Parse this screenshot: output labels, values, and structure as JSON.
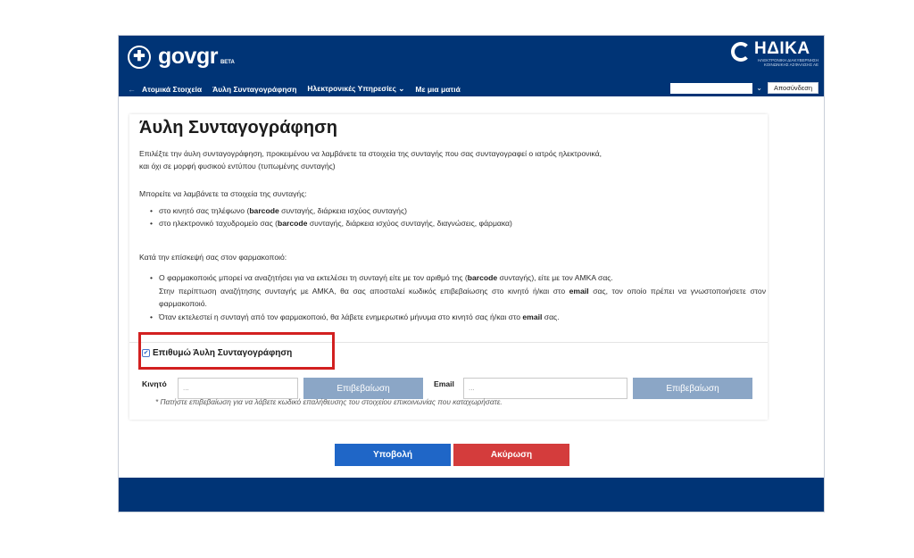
{
  "colors": {
    "header_bg": "#003476",
    "primary_button": "#1f66c7",
    "danger_button": "#d43c3c",
    "confirm_button": "#8ba6c6",
    "highlight_border": "#d22020"
  },
  "header": {
    "logo_gov": "gov",
    "logo_gr": "gr",
    "logo_beta": "BETA",
    "emblem_icon": "greek-emblem-icon",
    "org_name": "ΗΔΙΚΑ",
    "org_subtitle": "ΗΛΕΚΤΡΟΝΙΚΗ ΔΙΑΚΥΒΕΡΝΗΣΗ ΚΟΙΝΩΝΙΚΗΣ ΑΣΦΑΛΙΣΗΣ ΑΕ",
    "nav_items": [
      "Ατομικά Στοιχεία",
      "Άυλη Συνταγογράφηση",
      "Ηλεκτρονικές Υπηρεσίες ⌄",
      "Με μια ματιά"
    ],
    "user_select_value": "",
    "logout_label": "Αποσύνδεση"
  },
  "main": {
    "title": "Άυλη Συνταγογράφηση",
    "intro_line1": "Επιλέξτε την άυλη συνταγογράφηση, προκειμένου να λαμβάνετε τα στοιχεία της συνταγής που σας συνταγογραφεί ο ιατρός ηλεκτρονικά,",
    "intro_line2": "και όχι σε μορφή φυσικού εντύπου (τυπωμένης συνταγής)",
    "receive_heading": "Μπορείτε να λαμβάνετε τα στοιχεία της συνταγής:",
    "receive_items": [
      {
        "pre": "στο κινητό σας τηλέφωνο (",
        "kw": "barcode",
        "post": " συνταγής, διάρκεια ισχύος συνταγής)"
      },
      {
        "pre": "στο ηλεκτρονικό ταχυδρομείο σας (",
        "kw": "barcode",
        "post": " συνταγής, διάρκεια ισχύος συνταγής, διαγνώσεις, φάρμακα)"
      }
    ],
    "pharmacy_heading": "Κατά την επίσκεψή σας στον φαρμακοποιό:",
    "pharmacy_item1_pre": "Ο φαρμακοποιός μπορεί να αναζητήσει για να εκτελέσει τη συνταγή είτε με τον αριθμό της (",
    "pharmacy_item1_kw": "barcode",
    "pharmacy_item1_post": " συνταγής), είτε με τον ΑΜΚΑ σας.",
    "pharmacy_item1_cont_pre": "Στην περίπτωση αναζήτησης συνταγής με ΑΜΚΑ, θα σας αποσταλεί κωδικός επιβεβαίωσης στο κινητό ή/και στο ",
    "pharmacy_item1_cont_kw": "email",
    "pharmacy_item1_cont_post": " σας, τον οποίο πρέπει να γνωστοποιήσετε στον φαρμακοποιό.",
    "pharmacy_item2_pre": "Όταν εκτελεστεί η συνταγή από τον φαρμακοποιό, θα λάβετε ενημερωτικό μήνυμα στο κινητό σας ή/και στο ",
    "pharmacy_item2_kw": "email",
    "pharmacy_item2_post": " σας.",
    "checkbox_label": "Επιθυμώ Άυλη Συνταγογράφηση",
    "checkbox_checked": true,
    "mobile_label": "Κινητό",
    "mobile_placeholder": "...",
    "mobile_confirm_label": "Επιβεβαίωση",
    "email_label": "Email",
    "email_placeholder": "...",
    "email_confirm_label": "Επιβεβαίωση",
    "hint": "* Πατήστε επιβεβαίωση για να λάβετε κωδικό επαλήθευσης του στοιχείου επικοινωνίας που καταχωρήσατε."
  },
  "actions": {
    "submit_label": "Υποβολή",
    "cancel_label": "Ακύρωση"
  }
}
